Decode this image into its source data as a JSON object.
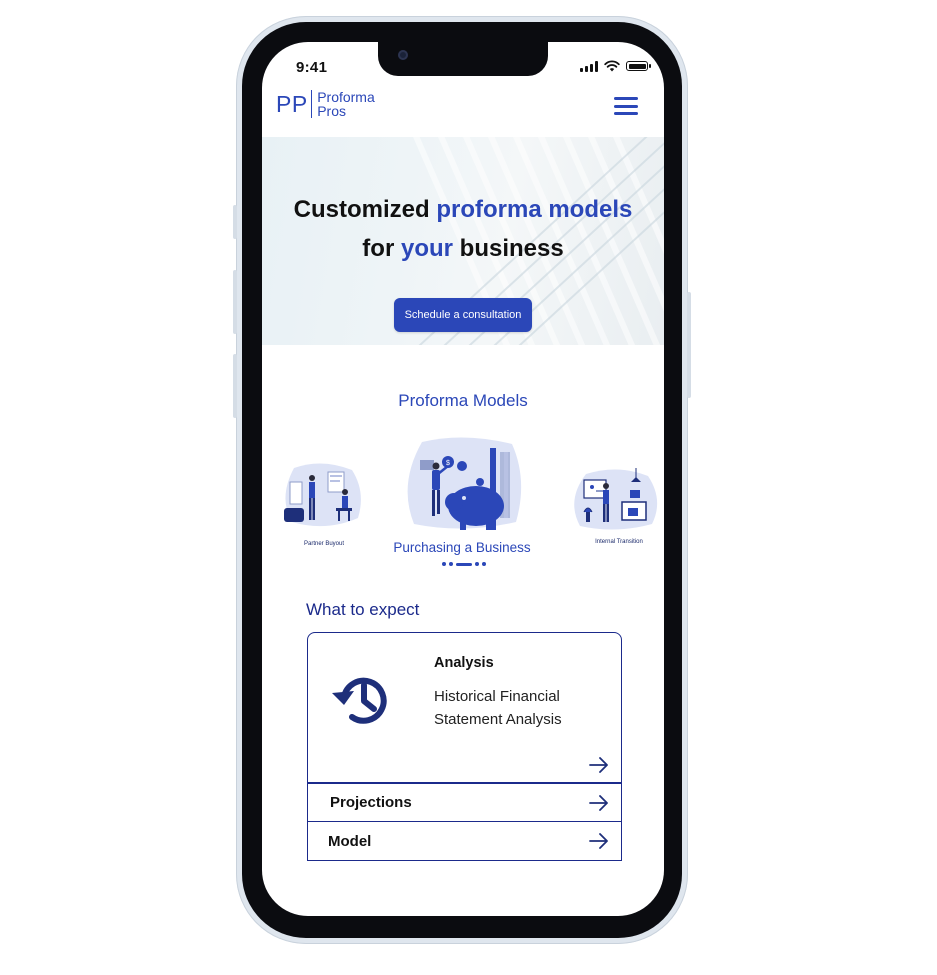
{
  "status_bar": {
    "time": "9:41"
  },
  "brand": {
    "mark": "PP",
    "name_line1": "Proforma",
    "name_line2": "Pros"
  },
  "hero": {
    "title_part1": "Customized ",
    "title_accent1": "proforma models",
    "title_part2": "for ",
    "title_accent2": "your",
    "title_part3": " business",
    "cta_label": "Schedule a consultation"
  },
  "models": {
    "title": "Proforma Models",
    "items": [
      {
        "label": "Partner Buyout",
        "icon": "partner-buyout-illustration"
      },
      {
        "label": "Purchasing a Business",
        "icon": "piggy-bank-illustration"
      },
      {
        "label": "Internal Transition",
        "icon": "internal-transition-illustration"
      }
    ]
  },
  "expect": {
    "title": "What to expect",
    "open_item": {
      "heading": "Analysis",
      "description": "Historical Financial Statement Analysis",
      "icon": "history-icon"
    },
    "items": [
      {
        "label": "Projections"
      },
      {
        "label": "Model"
      }
    ]
  },
  "colors": {
    "accent": "#2b47b8",
    "dark_accent": "#1b2a8b",
    "text": "#111111"
  }
}
